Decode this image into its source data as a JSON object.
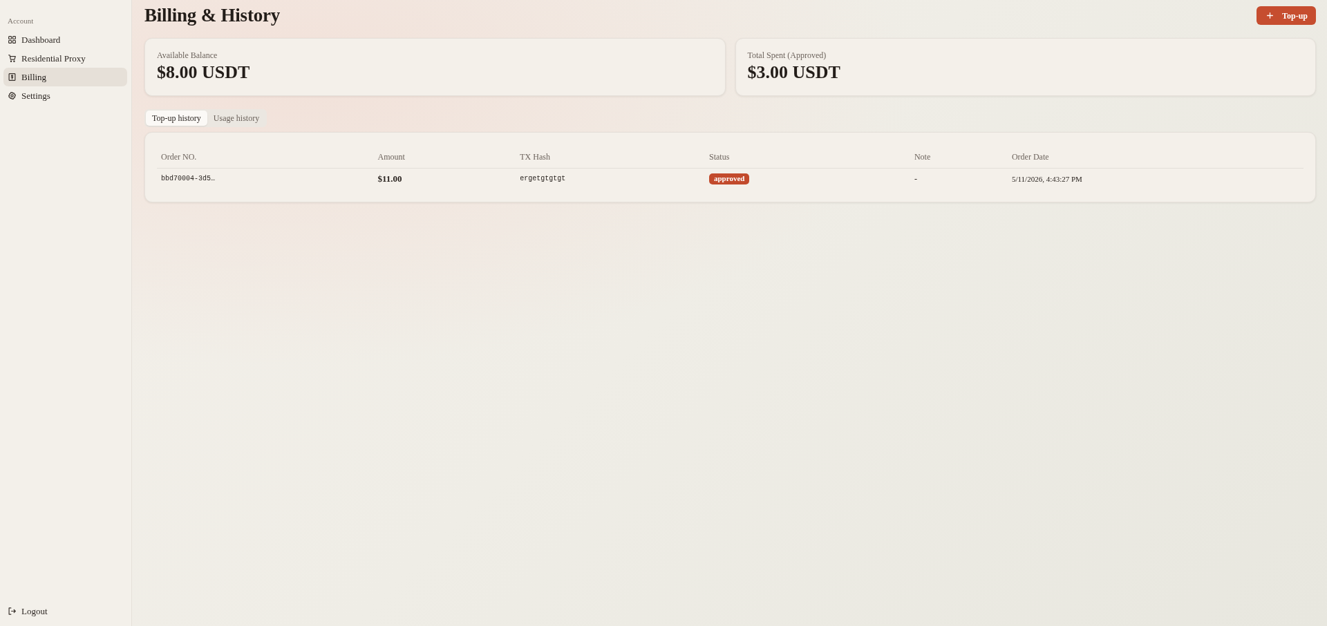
{
  "sidebar": {
    "section_label": "Account",
    "items": [
      {
        "label": "Dashboard",
        "selected": false
      },
      {
        "label": "Residential Proxy",
        "selected": false
      },
      {
        "label": "Billing",
        "selected": true
      },
      {
        "label": "Settings",
        "selected": false
      }
    ],
    "footer_item": {
      "label": "Logout"
    }
  },
  "header": {
    "title": "Billing & History",
    "action_button": {
      "label": "Top-up"
    }
  },
  "stats": [
    {
      "label": "Available Balance",
      "value": "$8.00 USDT"
    },
    {
      "label": "Total Spent (Approved)",
      "value": "$3.00 USDT"
    }
  ],
  "tabs": [
    {
      "label": "Top-up history",
      "selected": true
    },
    {
      "label": "Usage history",
      "selected": false
    }
  ],
  "table": {
    "columns": [
      "Order NO.",
      "Amount",
      "TX Hash",
      "Status",
      "Note",
      "Order Date"
    ],
    "rows": [
      {
        "order_no": "bbd70004-3d5…",
        "amount": "$11.00",
        "tx_hash": "ergetgtgtgt",
        "status": "approved",
        "note": "-",
        "order_date": "5/11/2026, 4:43:27 PM"
      }
    ]
  }
}
